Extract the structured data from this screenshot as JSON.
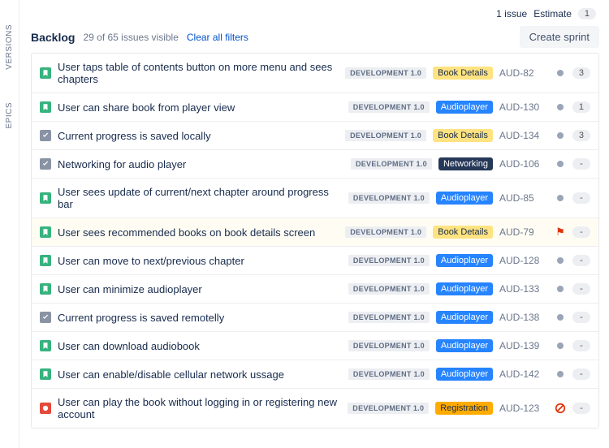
{
  "sidebar": {
    "tabs": [
      "VERSIONS",
      "EPICS"
    ]
  },
  "topbar": {
    "issue": "1 issue",
    "estimate": "Estimate",
    "estPill": "1"
  },
  "header": {
    "title": "Backlog",
    "count": "29 of 65 issues visible",
    "clear": "Clear all filters",
    "create": "Create sprint"
  },
  "version": "DEVELOPMENT 1.0",
  "epics": {
    "book": "Book Details",
    "audio": "Audioplayer",
    "net": "Networking",
    "reg": "Registration"
  },
  "issues": [
    {
      "type": "story",
      "sum": "User taps table of contents button on more menu and sees chapters",
      "epic": "book",
      "id": "AUD-82",
      "pri": "low",
      "est": "3"
    },
    {
      "type": "story",
      "sum": "User can share book from player view",
      "epic": "audio",
      "id": "AUD-130",
      "pri": "low",
      "est": "1"
    },
    {
      "type": "task",
      "sum": "Current progress is saved locally",
      "epic": "book",
      "id": "AUD-134",
      "pri": "low",
      "est": "3"
    },
    {
      "type": "task",
      "sum": "Networking for audio player",
      "epic": "net",
      "id": "AUD-106",
      "pri": "low",
      "est": "-"
    },
    {
      "type": "story",
      "sum": "User sees update of current/next chapter around progress bar",
      "epic": "audio",
      "id": "AUD-85",
      "pri": "low",
      "est": "-"
    },
    {
      "type": "story",
      "sum": "User sees recommended books on book details screen",
      "epic": "book",
      "id": "AUD-79",
      "pri": "flag",
      "est": "-",
      "flag": true
    },
    {
      "type": "story",
      "sum": "User can move to next/previous chapter",
      "epic": "audio",
      "id": "AUD-128",
      "pri": "low",
      "est": "-"
    },
    {
      "type": "story",
      "sum": "User can minimize audioplayer",
      "epic": "audio",
      "id": "AUD-133",
      "pri": "low",
      "est": "-"
    },
    {
      "type": "task",
      "sum": "Current progress is saved remotelly",
      "epic": "audio",
      "id": "AUD-138",
      "pri": "low",
      "est": "-"
    },
    {
      "type": "story",
      "sum": "User can download audiobook",
      "epic": "audio",
      "id": "AUD-139",
      "pri": "low",
      "est": "-"
    },
    {
      "type": "story",
      "sum": "User can enable/disable cellular network ussage",
      "epic": "audio",
      "id": "AUD-142",
      "pri": "low",
      "est": "-"
    },
    {
      "type": "bug",
      "sum": "User can play the book without logging in or registering new account",
      "epic": "reg",
      "id": "AUD-123",
      "pri": "block",
      "est": "-"
    }
  ]
}
